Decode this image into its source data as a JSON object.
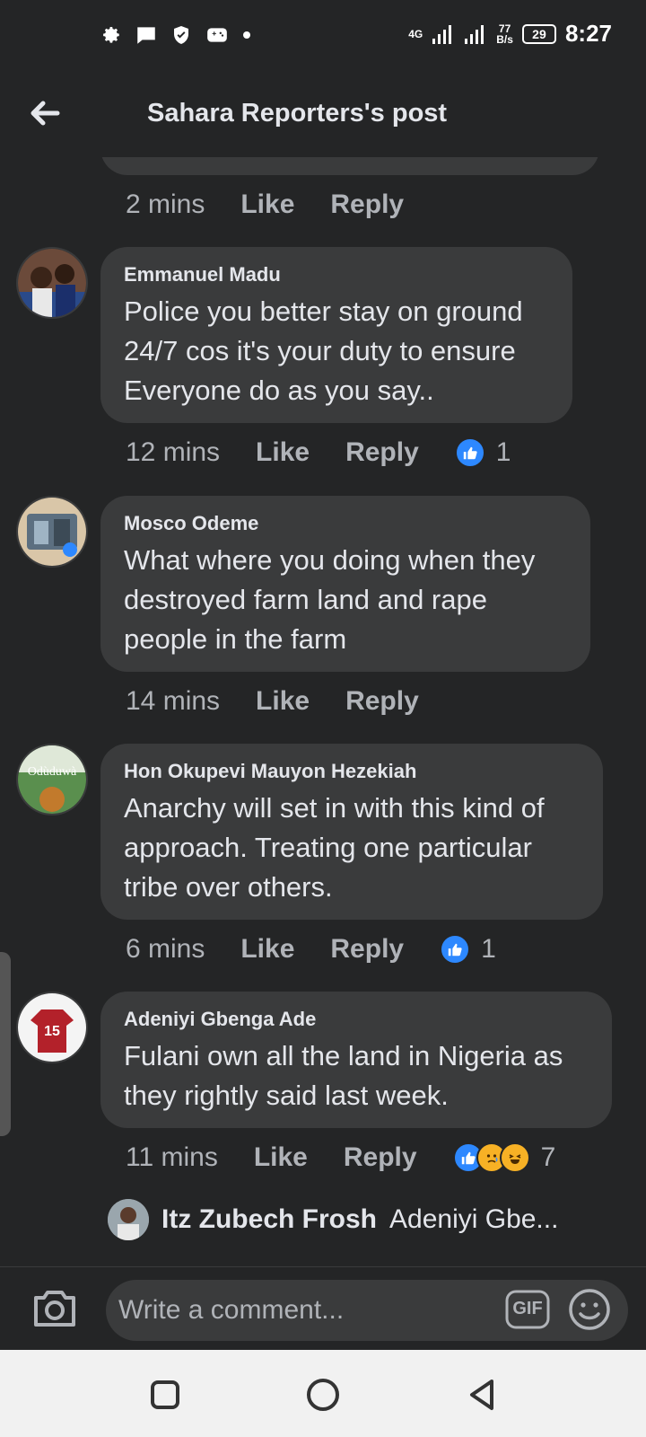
{
  "status_bar": {
    "network_type": "4G",
    "speed_value": "77",
    "speed_unit": "B/s",
    "battery": "29",
    "time": "8:27"
  },
  "header": {
    "title": "Sahara Reporters's post"
  },
  "previous_comment": {
    "time": "2 mins",
    "like": "Like",
    "reply": "Reply"
  },
  "comments": [
    {
      "author": "Emmanuel Madu",
      "text": "Police you better stay on ground 24/7 cos it's your duty to ensure Everyone do as you say..",
      "time": "12 mins",
      "like": "Like",
      "reply": "Reply",
      "reaction_count": "1"
    },
    {
      "author": "Mosco Odeme",
      "text": "What where you doing  when they destroyed farm land and rape people in the farm",
      "time": "14 mins",
      "like": "Like",
      "reply": "Reply"
    },
    {
      "author": "Hon Okupevi Mauyon Hezekiah",
      "avatar_text": "Odùduwà",
      "text": "Anarchy will set in with this kind of approach. Treating one particular tribe over others.",
      "time": "6 mins",
      "like": "Like",
      "reply": "Reply",
      "reaction_count": "1"
    },
    {
      "author": "Adeniyi Gbenga Ade",
      "avatar_text": "15",
      "text": "Fulani own all the land in Nigeria as they rightly said last week.",
      "time": "11 mins",
      "like": "Like",
      "reply": "Reply",
      "reaction_count": "7"
    }
  ],
  "reply_preview": {
    "author": "Itz Zubech Frosh",
    "snippet": "Adeniyi Gbe..."
  },
  "composer": {
    "placeholder": "Write a comment...",
    "gif_label": "GIF"
  },
  "colors": {
    "background": "#242526",
    "bubble": "#3a3b3c",
    "like_blue": "#2d88ff",
    "secondary_text": "#b0b3b8"
  }
}
